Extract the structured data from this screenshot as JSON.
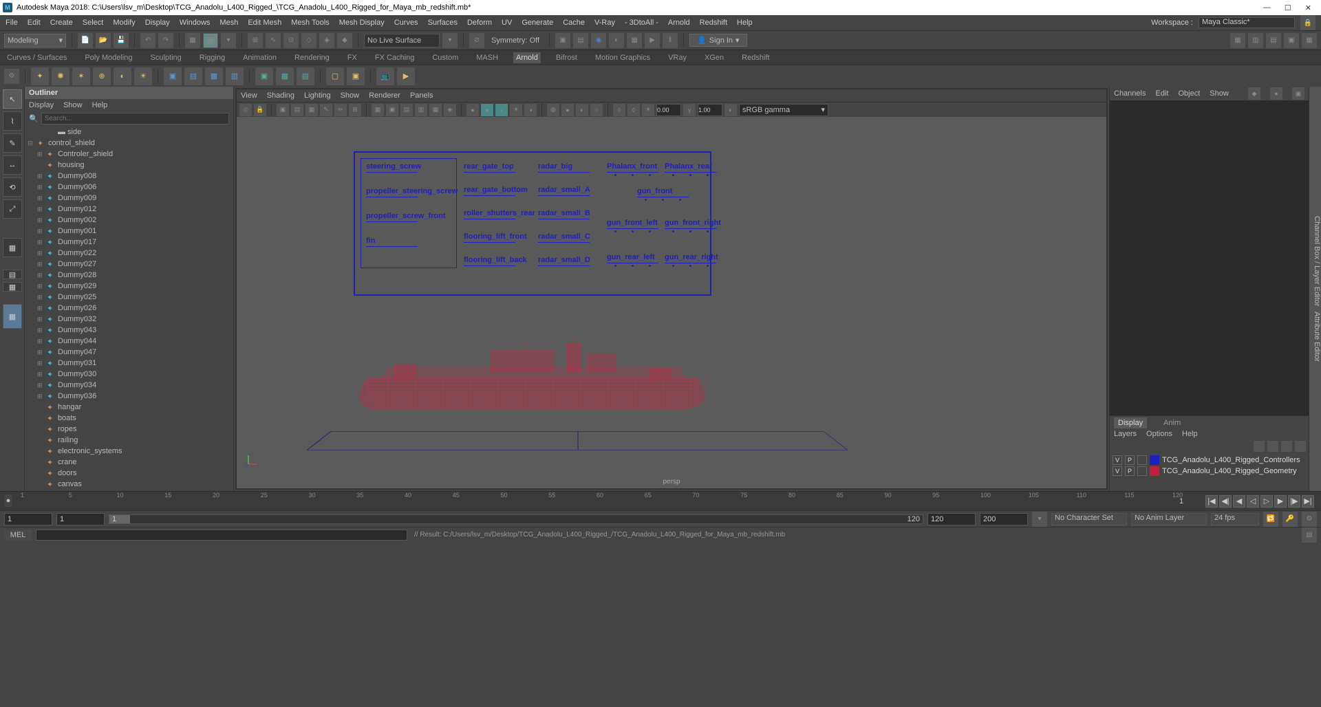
{
  "titlebar": {
    "app": "Autodesk Maya 2018: C:\\Users\\lsv_m\\Desktop\\TCG_Anadolu_L400_Rigged_\\TCG_Anadolu_L400_Rigged_for_Maya_mb_redshift.mb*"
  },
  "menu": {
    "items": [
      "File",
      "Edit",
      "Create",
      "Select",
      "Modify",
      "Display",
      "Windows",
      "Mesh",
      "Edit Mesh",
      "Mesh Tools",
      "Mesh Display",
      "Curves",
      "Surfaces",
      "Deform",
      "UV",
      "Generate",
      "Cache",
      "V-Ray",
      "- 3DtoAll -",
      "Arnold",
      "Redshift",
      "Help"
    ],
    "workspace_label": "Workspace :",
    "workspace_value": "Maya Classic*"
  },
  "toolbar": {
    "mode": "Modeling",
    "nolive": "No Live Surface",
    "symmetry": "Symmetry: Off",
    "signin": "Sign In"
  },
  "shelf": {
    "tabs": [
      "Curves / Surfaces",
      "Poly Modeling",
      "Sculpting",
      "Rigging",
      "Animation",
      "Rendering",
      "FX",
      "FX Caching",
      "Custom",
      "MASH",
      "Arnold",
      "Bifrost",
      "Motion Graphics",
      "VRay",
      "XGen",
      "Redshift"
    ],
    "active_tab": "Arnold"
  },
  "outliner": {
    "title": "Outliner",
    "menu": [
      "Display",
      "Show",
      "Help"
    ],
    "search_placeholder": "Search...",
    "side": "side",
    "root": "control_shield",
    "child1": "Controler_shield",
    "child2": "housing",
    "dummies": [
      "Dummy008",
      "Dummy006",
      "Dummy009",
      "Dummy012",
      "Dummy002",
      "Dummy001",
      "Dummy017",
      "Dummy022",
      "Dummy027",
      "Dummy028",
      "Dummy029",
      "Dummy025",
      "Dummy026",
      "Dummy032",
      "Dummy043",
      "Dummy044",
      "Dummy047",
      "Dummy031",
      "Dummy030",
      "Dummy034",
      "Dummy036"
    ],
    "others": [
      "hangar",
      "boats",
      "ropes",
      "railing",
      "electronic_systems",
      "crane",
      "doors",
      "canvas"
    ]
  },
  "viewport": {
    "menu": [
      "View",
      "Shading",
      "Lighting",
      "Show",
      "Renderer",
      "Panels"
    ],
    "exposure": "0.00",
    "gamma": "1.00",
    "colorspace": "sRGB gamma",
    "camera": "persp",
    "controllers": {
      "col1": [
        "steering_screw",
        "propeller_steering_screw",
        "propeller_screw_front",
        "fin"
      ],
      "col2": [
        "rear_gate_top",
        "rear_gate_bottom",
        "roller_shutters_rear",
        "flooring_lift_front",
        "flooring_lift_back"
      ],
      "col3": [
        "radar_big",
        "radar_small_A",
        "radar_small_B",
        "radar_small_C",
        "radar_small_D"
      ],
      "col4a": [
        "Phalanx_front"
      ],
      "col4b": [
        "Phalanx_rear"
      ],
      "col4c": [
        "gun_front"
      ],
      "col5": [
        "gun_front_left",
        "gun_front_right"
      ],
      "col6": [
        "gun_rear_left",
        "gun_rear_right"
      ]
    }
  },
  "right": {
    "tabs": [
      "Channels",
      "Edit",
      "Object",
      "Show"
    ],
    "side_label": "Channel Box / Layer Editor",
    "side_label2": "Attribute Editor",
    "bottabs": [
      "Display",
      "Anim"
    ],
    "botmenu": [
      "Layers",
      "Options",
      "Help"
    ],
    "layers": [
      {
        "v": "V",
        "p": "P",
        "color": "#2020c0",
        "name": "TCG_Anadolu_L400_Rigged_Controllers"
      },
      {
        "v": "V",
        "p": "P",
        "color": "#c02040",
        "name": "TCG_Anadolu_L400_Rigged_Geometry"
      }
    ]
  },
  "timeline": {
    "ticks": [
      "1",
      "5",
      "10",
      "15",
      "20",
      "25",
      "30",
      "35",
      "40",
      "45",
      "50",
      "55",
      "60",
      "65",
      "70",
      "75",
      "80",
      "85",
      "90",
      "95",
      "100",
      "105",
      "110",
      "115",
      "120"
    ],
    "current": "1"
  },
  "range": {
    "start": "1",
    "instart": "1",
    "inend": "120",
    "end": "120",
    "total": "200",
    "charset": "No Character Set",
    "animlayer": "No Anim Layer",
    "fps": "24 fps"
  },
  "cmd": {
    "lang": "MEL",
    "result": "// Result: C:/Users/lsv_m/Desktop/TCG_Anadolu_L400_Rigged_/TCG_Anadolu_L400_Rigged_for_Maya_mb_redshift.mb"
  }
}
